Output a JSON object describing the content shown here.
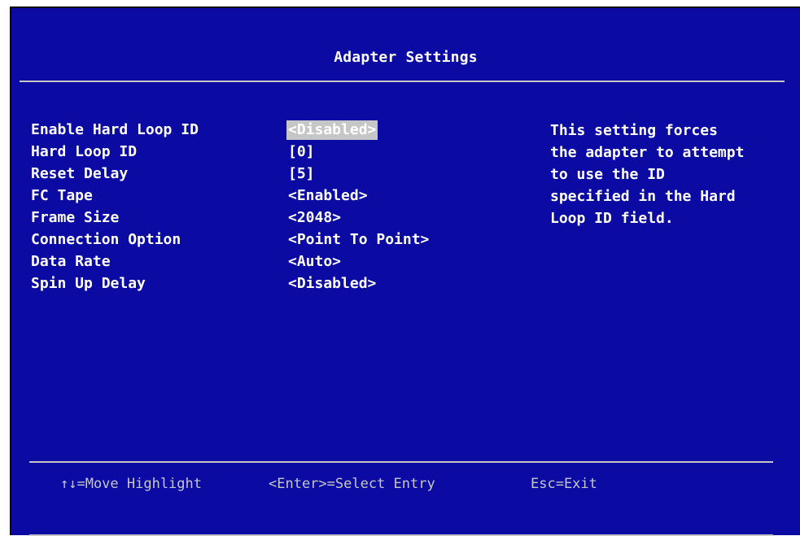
{
  "title": "Adapter Settings",
  "settings": [
    {
      "label": "Enable Hard Loop ID",
      "value": "<Disabled>"
    },
    {
      "label": "Hard Loop ID",
      "value": "[0]"
    },
    {
      "label": "Reset Delay",
      "value": "[5]"
    },
    {
      "label": "FC Tape",
      "value": "<Enabled>"
    },
    {
      "label": "Frame Size",
      "value": "<2048>"
    },
    {
      "label": "Connection Option",
      "value": "<Point To Point>"
    },
    {
      "label": "Data Rate",
      "value": "<Auto>"
    },
    {
      "label": "Spin Up Delay",
      "value": "<Disabled>"
    }
  ],
  "selected_index": 0,
  "help_text": "This setting forces\nthe adapter to attempt\nto use the ID\nspecified in the Hard\nLoop ID field.",
  "footer": {
    "move": "↑↓=Move Highlight",
    "select": "<Enter>=Select Entry",
    "exit": "Esc=Exit"
  },
  "colors": {
    "background": "#0b0ba4",
    "text": "#ffffff",
    "highlight": "#c6c6c6",
    "footer_text": "#c6c6c6"
  }
}
